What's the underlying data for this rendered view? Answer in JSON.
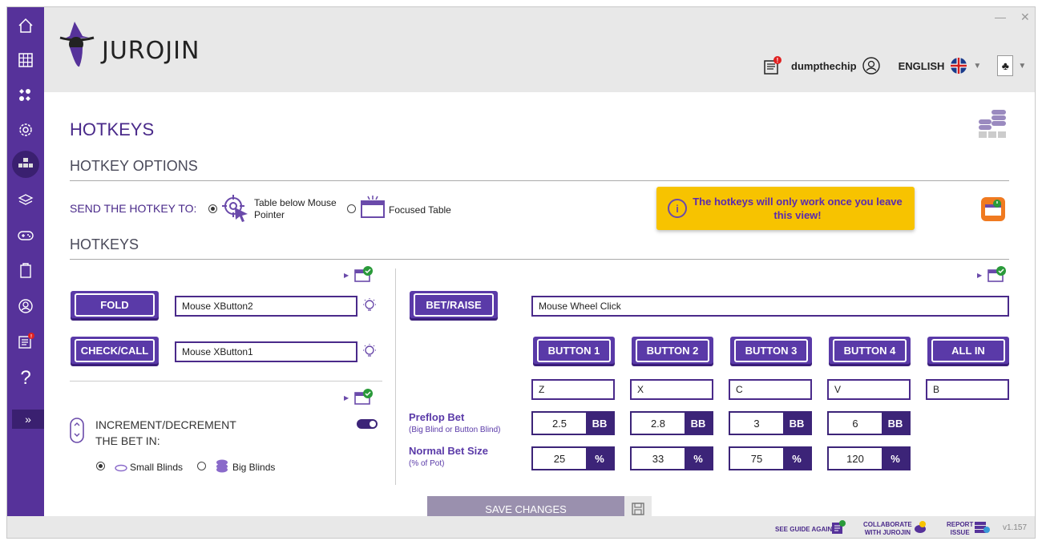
{
  "sidebar": {
    "items": [
      {
        "icon": "home-icon"
      },
      {
        "icon": "grid-icon"
      },
      {
        "icon": "card-suits-icon"
      },
      {
        "icon": "gear-icon"
      },
      {
        "icon": "hotkeys-icon"
      },
      {
        "icon": "layers-icon"
      },
      {
        "icon": "gamepad-icon"
      },
      {
        "icon": "clipboard-icon"
      },
      {
        "icon": "user-circle-icon"
      },
      {
        "icon": "news-icon"
      },
      {
        "icon": "help-icon",
        "glyph": "?"
      }
    ],
    "toggle": "»"
  },
  "header": {
    "logo_text": "JUROJIN",
    "username": "dumpthechip",
    "language": "ENGLISH",
    "window": {
      "minimize": "—",
      "close": "✕"
    }
  },
  "page": {
    "title": "HOTKEYS",
    "options_heading": "HOTKEY OPTIONS",
    "send_to_label": "SEND THE HOTKEY TO:",
    "send_options": [
      {
        "label": "Table below Mouse Pointer",
        "selected": true
      },
      {
        "label": "Focused Table",
        "selected": false
      }
    ],
    "notice": "The hotkeys will only work once you leave this view!",
    "hotkeys_heading": "HOTKEYS"
  },
  "left_panel": {
    "actions": [
      {
        "label": "FOLD",
        "binding": "Mouse XButton2"
      },
      {
        "label": "CHECK/CALL",
        "binding": "Mouse XButton1"
      }
    ],
    "increment_label": "INCREMENT/DECREMENT THE BET IN:",
    "increment_options": [
      {
        "label": "Small Blinds",
        "selected": true
      },
      {
        "label": "Big Blinds",
        "selected": false
      }
    ]
  },
  "right_panel": {
    "bet_raise_label": "BET/RAISE",
    "bet_raise_binding": "Mouse Wheel Click",
    "buttons": [
      {
        "label": "BUTTON 1",
        "key": "Z",
        "preflop": "2.5",
        "normal": "25"
      },
      {
        "label": "BUTTON 2",
        "key": "X",
        "preflop": "2.8",
        "normal": "33"
      },
      {
        "label": "BUTTON 3",
        "key": "C",
        "preflop": "3",
        "normal": "75"
      },
      {
        "label": "BUTTON 4",
        "key": "V",
        "preflop": "6",
        "normal": "120"
      },
      {
        "label": "ALL IN",
        "key": "B"
      }
    ],
    "preflop_title": "Preflop Bet",
    "preflop_sub": "(Big Blind or Button Blind)",
    "preflop_unit": "BB",
    "normal_title": "Normal Bet Size",
    "normal_sub": "(% of Pot)",
    "normal_unit": "%"
  },
  "save_label": "SAVE CHANGES",
  "footer": {
    "guide": "SEE GUIDE AGAIN",
    "collab_1": "COLLABORATE",
    "collab_2": "WITH JUROJIN",
    "report_1": "REPORT",
    "report_2": "ISSUE",
    "version": "v1.157"
  },
  "colors": {
    "primary": "#56329a",
    "dark": "#3c2478",
    "notice": "#f7c300"
  }
}
